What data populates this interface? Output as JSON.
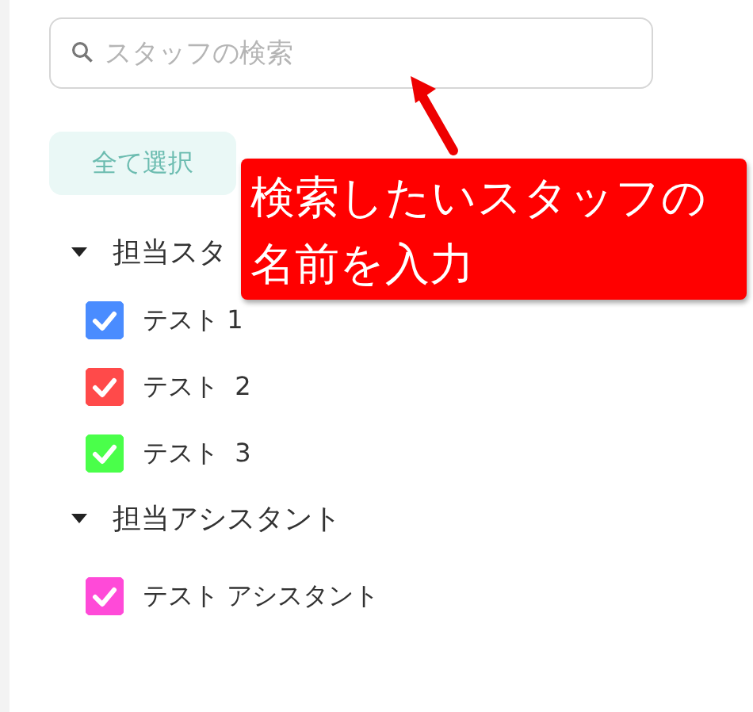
{
  "search": {
    "placeholder": "スタッフの検索"
  },
  "select_all_button": "全て選択",
  "groups": [
    {
      "title": "担当スタ",
      "expanded": true,
      "items": [
        {
          "label": "テスト 1",
          "checked": true,
          "color": "#4a8cff"
        },
        {
          "label": "テスト  2",
          "checked": true,
          "color": "#ff4a4a"
        },
        {
          "label": "テスト  3",
          "checked": true,
          "color": "#4aff4a"
        }
      ]
    },
    {
      "title": "担当アシスタント",
      "expanded": true,
      "items": [
        {
          "label": "テスト アシスタント",
          "checked": true,
          "color": "#ff4ad8"
        }
      ]
    }
  ],
  "callout": {
    "text": "検索したいスタッフの名前を入力"
  }
}
